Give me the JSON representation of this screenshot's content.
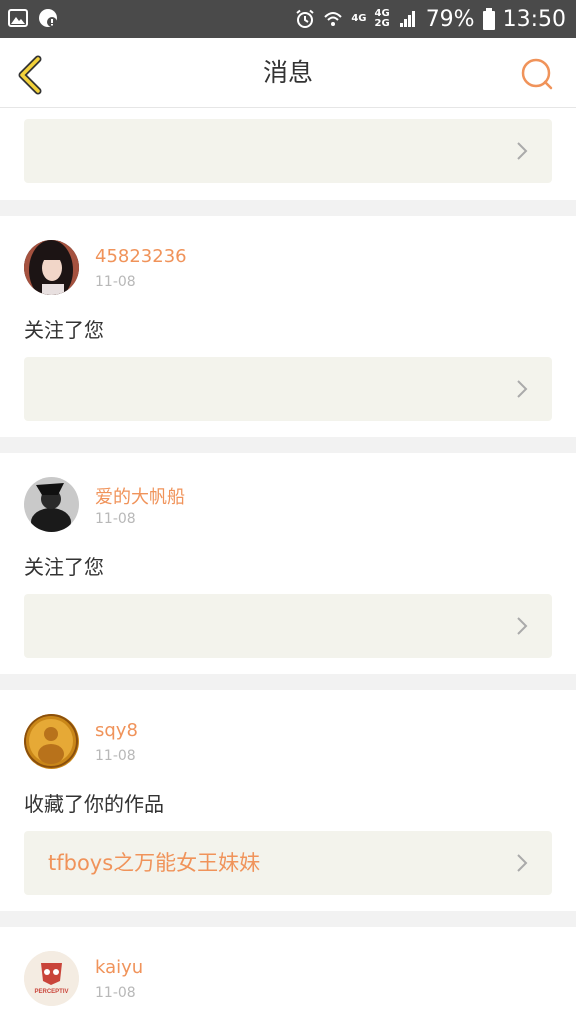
{
  "statusbar": {
    "network_4g": "4G",
    "network_4g2": "4G",
    "network_2g": "2G",
    "battery_pct": "79%",
    "time": "13:50",
    "icons": [
      "image-icon",
      "message-icon",
      "alarm-icon",
      "wifi-icon",
      "signal-icon",
      "battery-icon"
    ]
  },
  "nav": {
    "title": "消息",
    "back_icon": "chevron-left-icon",
    "search_icon": "search-icon"
  },
  "colors": {
    "accent": "#f0935a",
    "box_bg": "#f3f3ec",
    "text": "#333333",
    "muted": "#b8b8b8"
  },
  "messages": [
    {
      "username": "45823236",
      "date": "11-08",
      "action": "关注了您",
      "work_title": ""
    },
    {
      "username": "爱的大帆船",
      "date": "11-08",
      "action": "关注了您",
      "work_title": ""
    },
    {
      "username": "sqy8",
      "date": "11-08",
      "action": "收藏了你的作品",
      "work_title": "tfboys之万能女王妹妹"
    },
    {
      "username": "kaiyu",
      "date": "11-08",
      "avatar_text": "PERCEPTIV"
    }
  ]
}
